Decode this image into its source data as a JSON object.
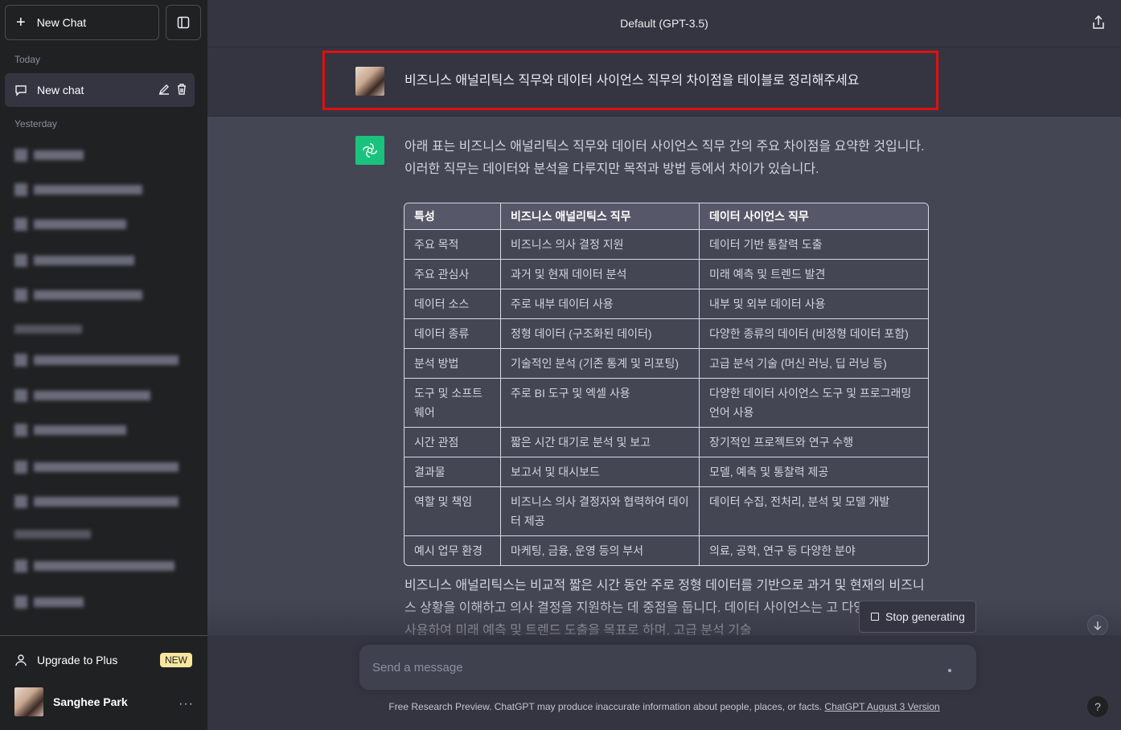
{
  "sidebar": {
    "new_chat_label": "New Chat",
    "today_label": "Today",
    "active_chat_label": "New chat",
    "yesterday_label": "Yesterday",
    "upgrade_label": "Upgrade to Plus",
    "new_badge": "NEW",
    "user_name": "Sanghee Park",
    "more_label": "···"
  },
  "header": {
    "model_label": "Default (GPT-3.5)"
  },
  "conversation": {
    "user_message": "비즈니스 애널리틱스 직무와 데이터 사이언스 직무의 차이점을 테이블로 정리해주세요",
    "intro": "아래 표는 비즈니스 애널리틱스 직무와 데이터 사이언스 직무 간의 주요 차이점을 요약한 것입니다. 이러한 직무는 데이터와 분석을 다루지만 목적과 방법 등에서 차이가 있습니다.",
    "table": {
      "headers": [
        "특성",
        "비즈니스 애널리틱스 직무",
        "데이터 사이언스 직무"
      ],
      "rows": [
        [
          "주요 목적",
          "비즈니스 의사 결정 지원",
          "데이터 기반 통찰력 도출"
        ],
        [
          "주요 관심사",
          "과거 및 현재 데이터 분석",
          "미래 예측 및 트렌드 발견"
        ],
        [
          "데이터 소스",
          "주로 내부 데이터 사용",
          "내부 및 외부 데이터 사용"
        ],
        [
          "데이터 종류",
          "정형 데이터 (구조화된 데이터)",
          "다양한 종류의 데이터 (비정형 데이터 포함)"
        ],
        [
          "분석 방법",
          "기술적인 분석 (기존 통계 및 리포팅)",
          "고급 분석 기술 (머신 러닝, 딥 러닝 등)"
        ],
        [
          "도구 및 소프트웨어",
          "주로 BI 도구 및 엑셀 사용",
          "다양한 데이터 사이언스 도구 및 프로그래밍 언어 사용"
        ],
        [
          "시간 관점",
          "짧은 시간 대기로 분석 및 보고",
          "장기적인 프로젝트와 연구 수행"
        ],
        [
          "결과물",
          "보고서 및 대시보드",
          "모델, 예측 및 통찰력 제공"
        ],
        [
          "역할 및 책임",
          "비즈니스 의사 결정자와 협력하여 데이터 제공",
          "데이터 수집, 전처리, 분석 및 모델 개발"
        ],
        [
          "예시 업무 환경",
          "마케팅, 금융, 운영 등의 부서",
          "의료, 공학, 연구 등 다양한 분야"
        ]
      ]
    },
    "outro": "비즈니스 애널리틱스는 비교적 짧은 시간 동안 주로 정형 데이터를 기반으로 과거 및 현재의 비즈니스 상황을 이해하고 의사 결정을 지원하는 데 중점을 둡니다. 데이터 사이언스는 고 다양한 데이터를 사용하여 미래 예측 및 트렌드 도출을 목표로 하며, 고급 분석 기술"
  },
  "controls": {
    "stop_label": "Stop generating",
    "input_placeholder": "Send a message",
    "disclaimer_text": "Free Research Preview. ChatGPT may produce inaccurate information about people, places, or facts. ",
    "disclaimer_link": "ChatGPT August 3 Version",
    "help_label": "?"
  }
}
